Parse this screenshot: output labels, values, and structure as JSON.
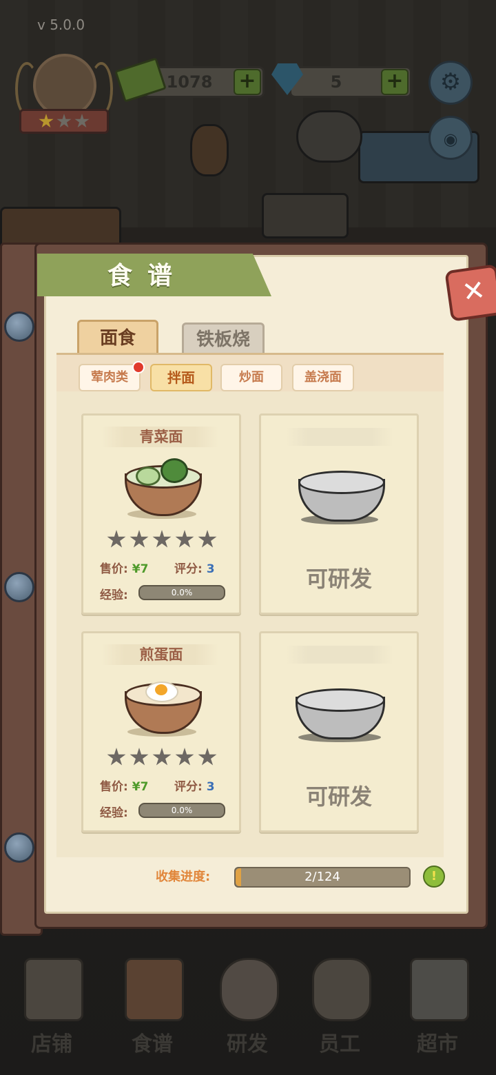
{
  "hud": {
    "version": "v  5.0.0",
    "money": "1078",
    "gems": "5",
    "plus": "+",
    "rank_stars_on": 1,
    "rank_stars_total": 3,
    "settings_icon": "gear-icon",
    "camera_icon": "camera-icon"
  },
  "panel": {
    "title": "食谱",
    "close": "✕",
    "tabs": [
      "面食",
      "铁板烧"
    ],
    "subtabs": [
      "荤肉类",
      "拌面",
      "炒面",
      "盖浇面"
    ],
    "active_subtab": 1
  },
  "recipes": [
    {
      "name": "青菜面",
      "stars": 5,
      "price_label": "售价:",
      "price": "¥7",
      "score_label": "评分:",
      "score": "3",
      "exp_label": "经验:",
      "exp": "0.0%",
      "bowl_color": "#b07a55"
    },
    {
      "locked": true,
      "status": "可研发"
    },
    {
      "name": "煎蛋面",
      "stars": 5,
      "price_label": "售价:",
      "price": "¥7",
      "score_label": "评分:",
      "score": "3",
      "exp_label": "经验:",
      "exp": "0.0%",
      "bowl_color": "#b07a55"
    },
    {
      "locked": true,
      "status": "可研发"
    }
  ],
  "progress": {
    "label": "收集进度:",
    "text": "2/124",
    "value": 2,
    "total": 124,
    "info": "!"
  },
  "nav": [
    "店铺",
    "食谱",
    "研发",
    "员工",
    "超市"
  ],
  "colors": {
    "accent_green": "#8fa25a",
    "close_red": "#d96c5f",
    "price_green": "#4e9a2a",
    "score_blue": "#3b6fb6",
    "progress_orange": "#e1863a"
  }
}
